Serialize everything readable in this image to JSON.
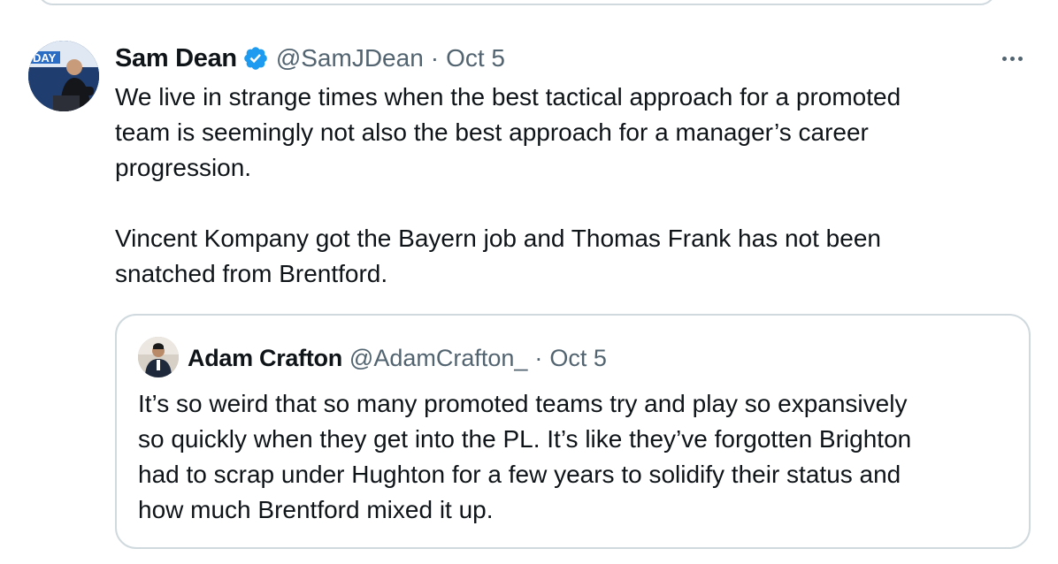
{
  "tweet": {
    "author_name": "Sam Dean",
    "handle": "@SamJDean",
    "separator": "·",
    "date": "Oct 5",
    "verified": true,
    "avatar_badge_text": "DAY",
    "paragraphs": [
      "We live in strange times when the best tactical approach for a promoted\nteam is seemingly not also the best approach for a manager’s career\nprogression.",
      "Vincent Kompany got the Bayern job and Thomas Frank has not been\nsnatched from Brentford."
    ],
    "more_icon": "more-horizontal-icon"
  },
  "quoted_tweet": {
    "author_name": "Adam Crafton",
    "handle": "@AdamCrafton_",
    "separator": "·",
    "date": "Oct 5",
    "text": "It’s so weird that so many promoted teams try and play so expansively\nso quickly when they get into the PL. It’s like they’ve forgotten Brighton\nhad to scrap under Hughton for a few years to solidify their status and\nhow much Brentford mixed it up."
  },
  "colors": {
    "text_primary": "#0f1419",
    "text_secondary": "#536471",
    "border": "#cfd9de",
    "verified_blue": "#1d9bf0"
  }
}
